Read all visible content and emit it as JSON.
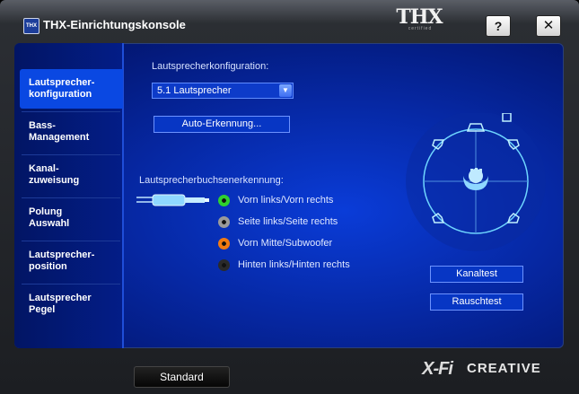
{
  "window": {
    "title": "THX-Einrichtungskonsole",
    "app_icon_text": "THX",
    "help_label": "?",
    "close_label": "✕",
    "thx_logo": "THX",
    "thx_logo_sub": "certified"
  },
  "sidebar": {
    "items": [
      {
        "line1": "Lautsprecher-",
        "line2": "konfiguration",
        "active": true
      },
      {
        "line1": "Bass-",
        "line2": "Management",
        "active": false
      },
      {
        "line1": "Kanal-",
        "line2": "zuweisung",
        "active": false
      },
      {
        "line1": "Polung",
        "line2": "Auswahl",
        "active": false
      },
      {
        "line1": "Lautsprecher-",
        "line2": "position",
        "active": false
      },
      {
        "line1": "Lautsprecher",
        "line2": "Pegel",
        "active": false
      }
    ]
  },
  "main": {
    "config_label": "Lautsprecherkonfiguration:",
    "config_value": "5.1 Lautsprecher",
    "auto_detect_label": "Auto-Erkennung...",
    "jack_detect_label": "Lautsprecherbuchsenerkennung:",
    "jacks": [
      {
        "label": "Vorn links/Vorn rechts",
        "color": "#2fd12f"
      },
      {
        "label": "Seite links/Seite rechts",
        "color": "#9a9a9a"
      },
      {
        "label": "Vorn Mitte/Subwoofer",
        "color": "#f07a12"
      },
      {
        "label": "Hinten links/Hinten rechts",
        "color": "#2a2a2a"
      }
    ],
    "channel_test_label": "Kanaltest",
    "noise_test_label": "Rauschtest"
  },
  "footer": {
    "standard_label": "Standard",
    "xfi_logo": "X-Fi",
    "creative_logo": "CREATIVE"
  },
  "colors": {
    "accent": "#0a48e2",
    "diagram_line": "#6fd6ff"
  }
}
